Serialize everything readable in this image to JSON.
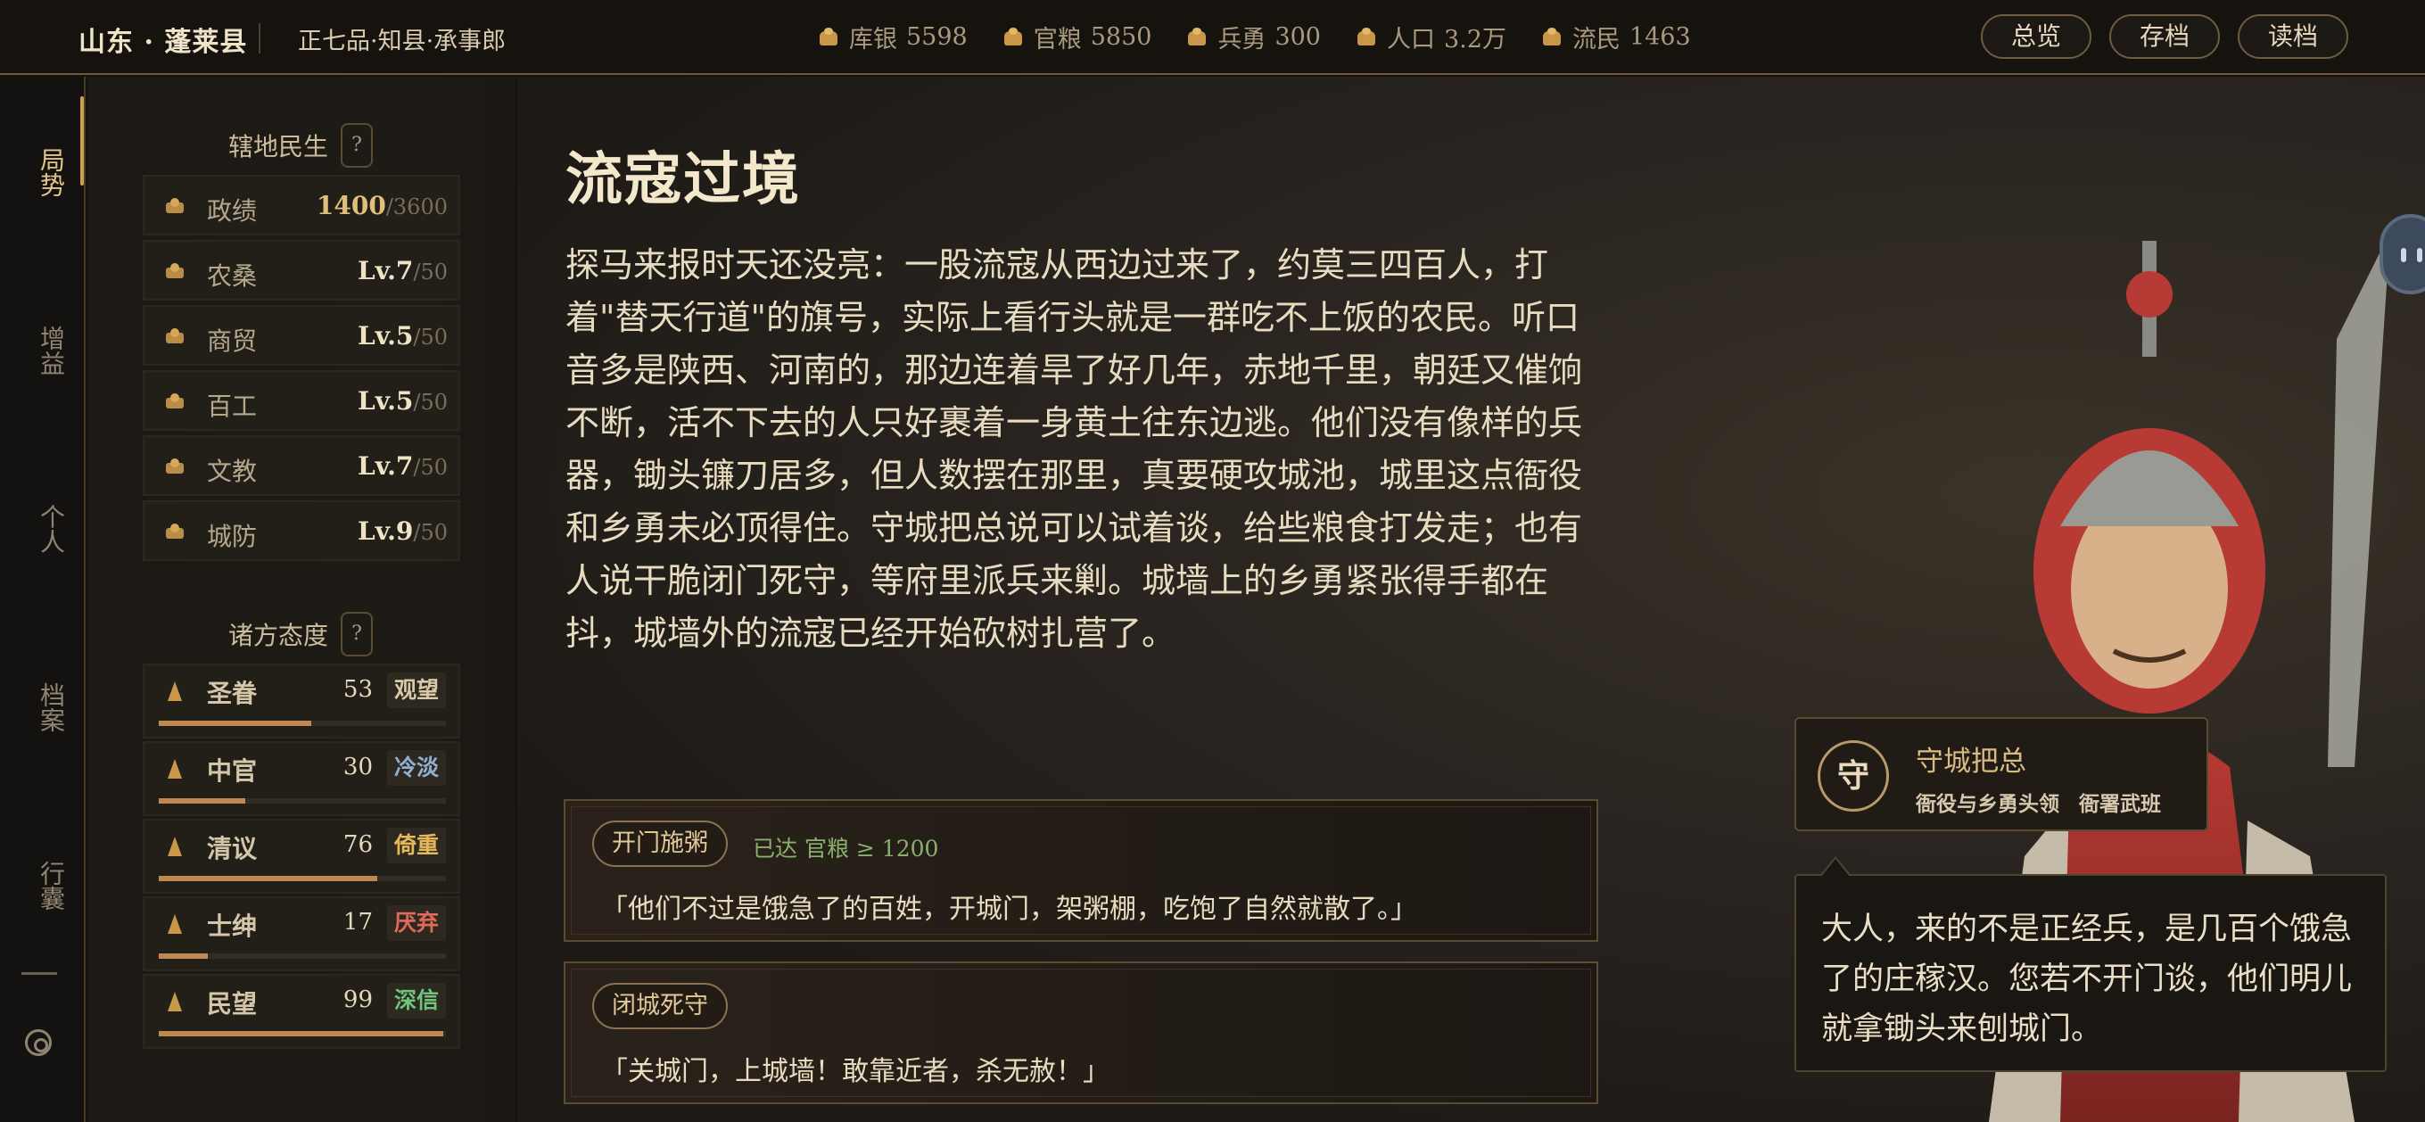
{
  "header": {
    "region": "山东 · 蓬莱县",
    "rank": "正七品·知县·承事郎",
    "resources": [
      {
        "label": "库银",
        "value": "5598",
        "icon": "silver-icon"
      },
      {
        "label": "官粮",
        "value": "5850",
        "icon": "grain-icon"
      },
      {
        "label": "兵勇",
        "value": "300",
        "icon": "soldier-icon"
      },
      {
        "label": "人口",
        "value": "3.2万",
        "icon": "population-icon"
      },
      {
        "label": "流民",
        "value": "1463",
        "icon": "refugee-icon"
      }
    ],
    "buttons": {
      "overview": "总览",
      "save": "存档",
      "load": "读档"
    }
  },
  "nav": {
    "items": [
      "局势",
      "增益",
      "个人",
      "档案",
      "行囊"
    ],
    "active": "局势",
    "settings_icon": "settings-icon"
  },
  "sidebar": {
    "governance_title": "辖地民生",
    "help": "?",
    "stats": [
      {
        "label": "政绩",
        "value": "1400",
        "max": "/3600"
      },
      {
        "label": "农桑",
        "value": "Lv.7",
        "max": "/50"
      },
      {
        "label": "商贸",
        "value": "Lv.5",
        "max": "/50"
      },
      {
        "label": "百工",
        "value": "Lv.5",
        "max": "/50"
      },
      {
        "label": "文教",
        "value": "Lv.7",
        "max": "/50"
      },
      {
        "label": "城防",
        "value": "Lv.9",
        "max": "/50"
      }
    ],
    "attitude_title": "诸方态度",
    "attitudes": [
      {
        "label": "圣眷",
        "value": "53",
        "tag": "观望",
        "tag_color": "#d8c9a8",
        "fill": 0.53
      },
      {
        "label": "中官",
        "value": "30",
        "tag": "冷淡",
        "tag_color": "#8fb0d0",
        "fill": 0.3
      },
      {
        "label": "清议",
        "value": "76",
        "tag": "倚重",
        "tag_color": "#e6b858",
        "fill": 0.76
      },
      {
        "label": "士绅",
        "value": "17",
        "tag": "厌弃",
        "tag_color": "#e06a5a",
        "fill": 0.17
      },
      {
        "label": "民望",
        "value": "99",
        "tag": "深信",
        "tag_color": "#6ec47a",
        "fill": 0.99
      }
    ]
  },
  "event": {
    "title": "流寇过境",
    "body": "探马来报时天还没亮：一股流寇从西边过来了，约莫三四百人，打着\"替天行道\"的旗号，实际上看行头就是一群吃不上饭的农民。听口音多是陕西、河南的，那边连着旱了好几年，赤地千里，朝廷又催饷不断，活不下去的人只好裹着一身黄土往东边逃。他们没有像样的兵器，锄头镰刀居多，但人数摆在那里，真要硬攻城池，城里这点衙役和乡勇未必顶得住。守城把总说可以试着谈，给些粮食打发走；也有人说干脆闭门死守，等府里派兵来剿。城墙上的乡勇紧张得手都在抖，城墙外的流寇已经开始砍树扎营了。",
    "choices": [
      {
        "label": "开门施粥",
        "status": "已达 官粮 ≥ 1200",
        "quote": "「他们不过是饿急了的百姓，开城门，架粥棚，吃饱了自然就散了。」"
      },
      {
        "label": "闭城死守",
        "status": "",
        "quote": "「关城门，上城墙！敢靠近者，杀无赦！」"
      }
    ]
  },
  "npc": {
    "seal": "守",
    "name": "守城把总",
    "desc1": "衙役与乡勇头领",
    "desc2": "衙署武班",
    "speech": "大人，来的不是正经兵，是几百个饿急了的庄稼汉。您若不开门谈，他们明儿就拿锄头来刨城门。"
  }
}
